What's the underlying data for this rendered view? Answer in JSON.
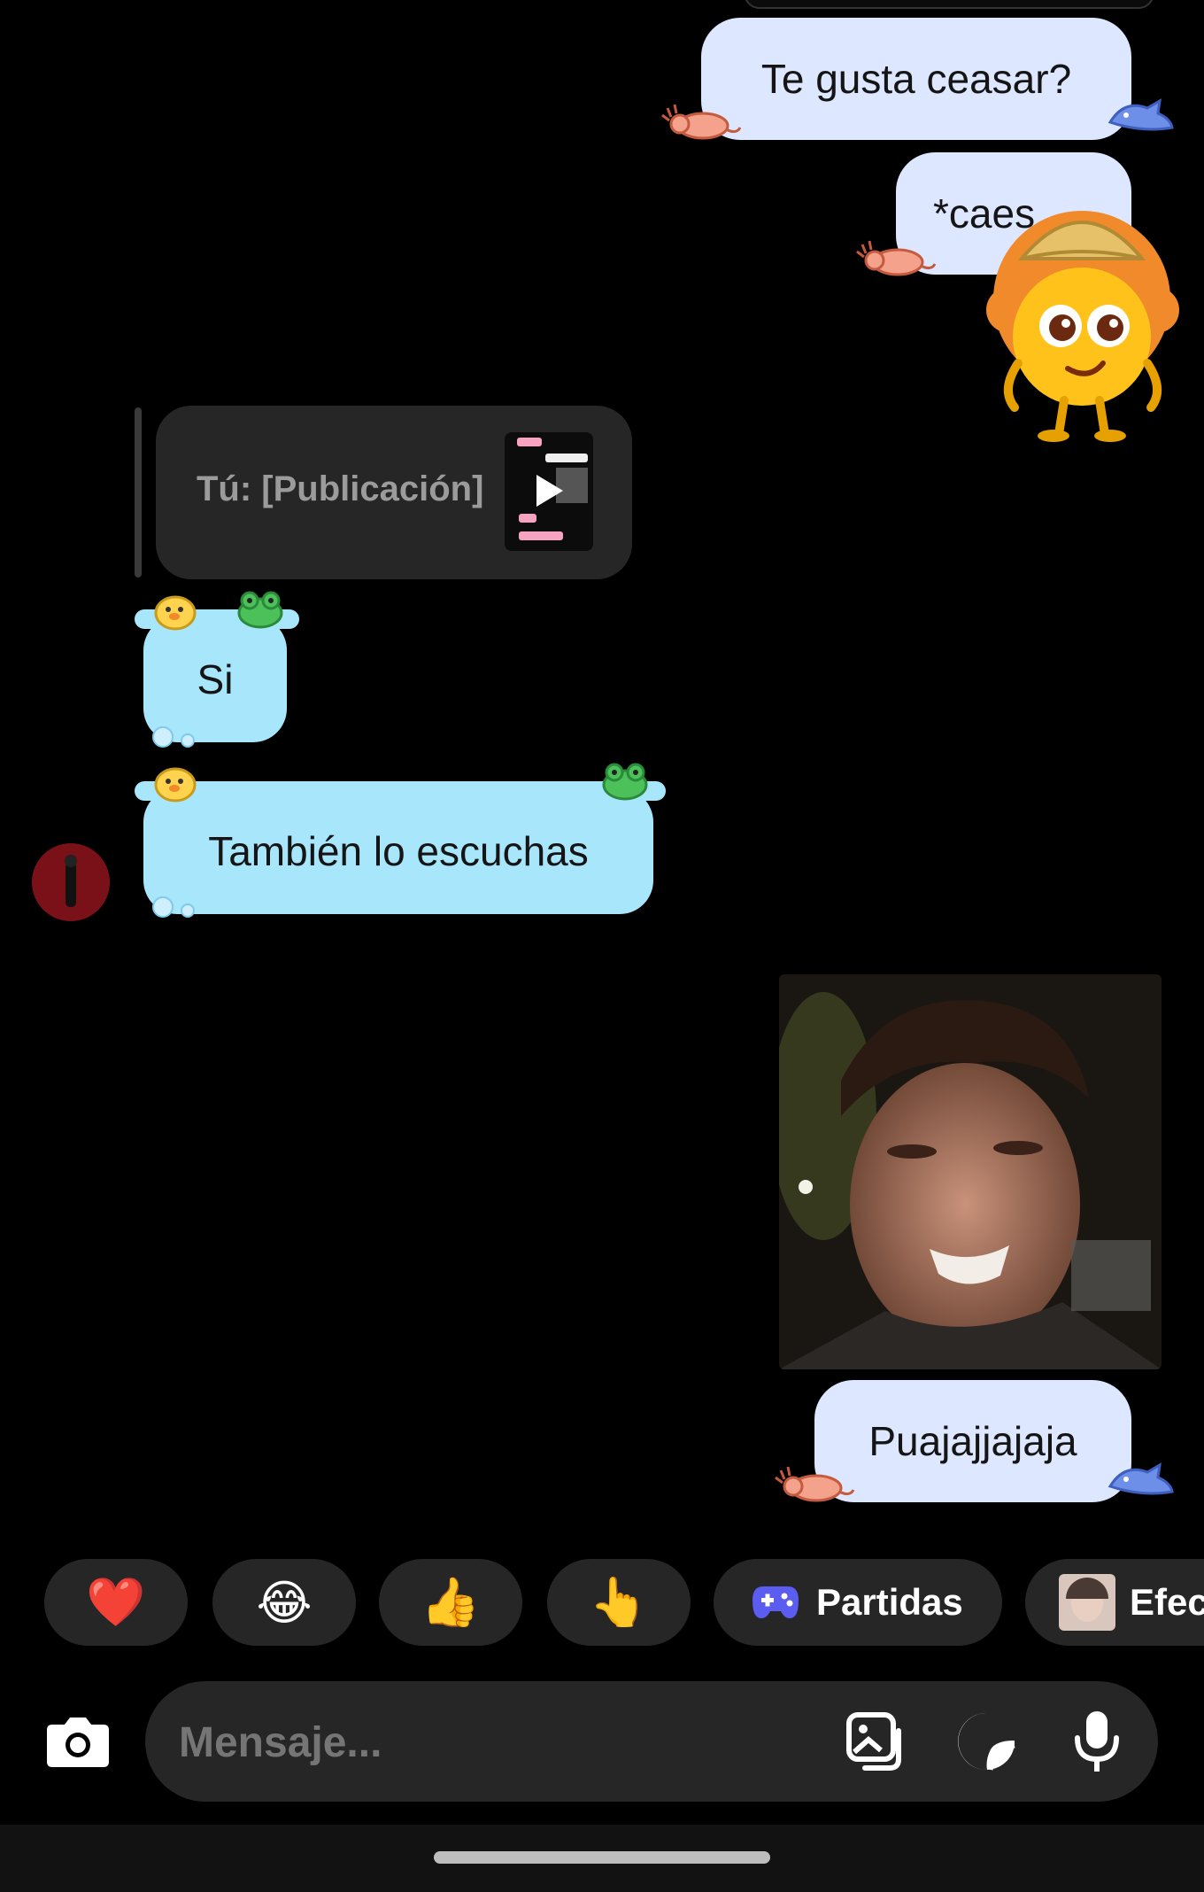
{
  "messages": {
    "outgoing_1": "Te gusta ceasar?",
    "outgoing_2": "*caes",
    "reply_preview": "Tú: [Publicación]",
    "incoming_1": "Si",
    "incoming_2": "También lo escuchas",
    "outgoing_3": "Puajajjajaja"
  },
  "quick_replies": {
    "reaction_1": "❤️",
    "reaction_2": "😂",
    "reaction_3": "👍",
    "reaction_4": "👆",
    "games_label": "Partidas",
    "effects_label": "Efec"
  },
  "composer": {
    "placeholder": "Mensaje..."
  },
  "colors": {
    "outgoing_bubble": "#dde7ff",
    "incoming_bubble": "#a8e6fb",
    "chip_background": "#262626",
    "composer_background": "#262626"
  },
  "icons": [
    "camera-icon",
    "gallery-icon",
    "sticker-icon",
    "microphone-icon",
    "gamepad-icon"
  ]
}
